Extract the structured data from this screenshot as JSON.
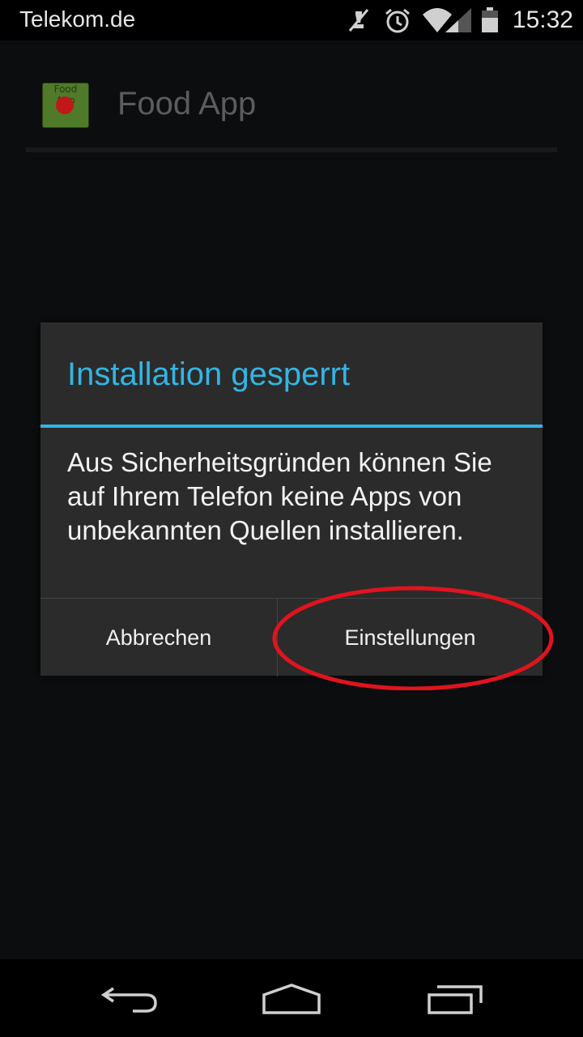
{
  "status_bar": {
    "carrier": "Telekom.de",
    "time": "15:32",
    "icons": [
      "muted-icon",
      "alarm-icon",
      "wifi-icon",
      "signal-icon",
      "battery-icon"
    ]
  },
  "app_bar": {
    "title": "Food App",
    "logo_text": "Food App"
  },
  "dialog": {
    "title": "Installation gesperrt",
    "message": "Aus Sicherheitsgründen können Sie auf Ihrem Telefon keine Apps von unbekannten Quellen installieren.",
    "cancel_label": "Abbrechen",
    "settings_label": "Einstellungen",
    "accent_color": "#33b5e5"
  },
  "annotation": {
    "highlight_color": "#e0141e",
    "highlights": "Einstellungen"
  },
  "nav_bar": {
    "icons": [
      "back-icon",
      "home-icon",
      "recent-apps-icon"
    ]
  }
}
